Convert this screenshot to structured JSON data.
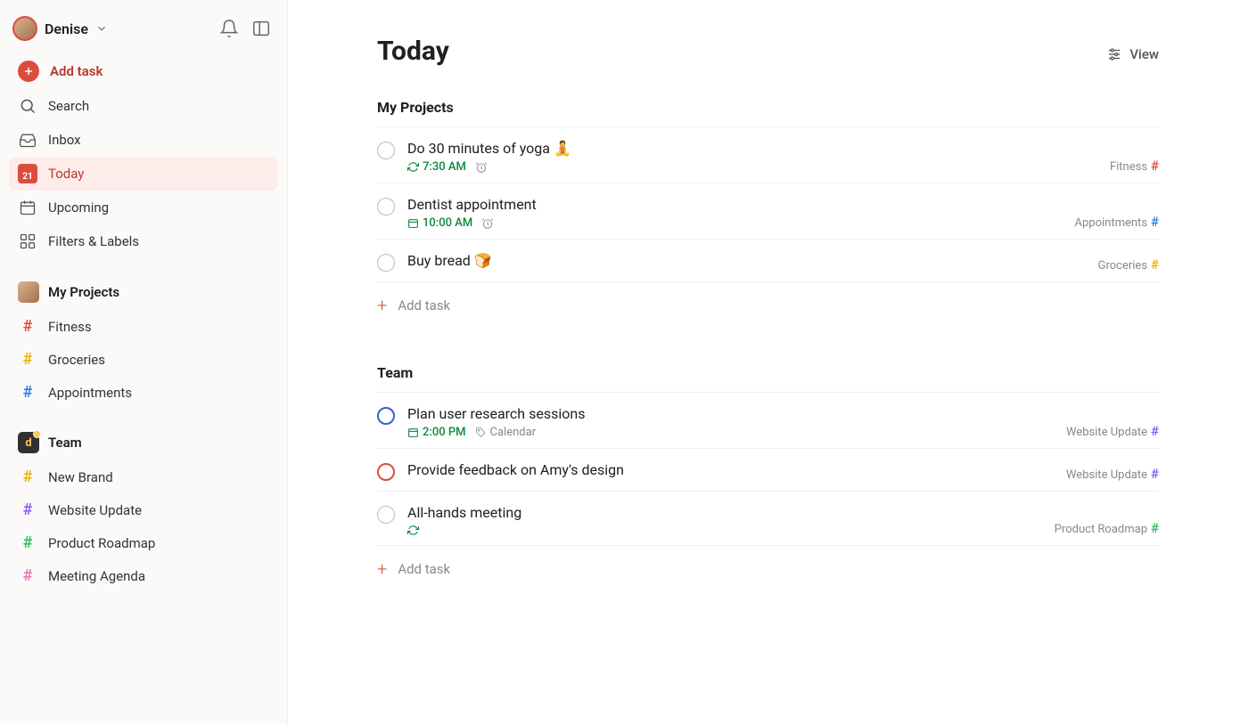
{
  "user": {
    "name": "Denise"
  },
  "sidebar": {
    "add_task": "Add task",
    "nav": [
      {
        "label": "Search",
        "icon": "search"
      },
      {
        "label": "Inbox",
        "icon": "inbox"
      },
      {
        "label": "Today",
        "icon": "calendar-today",
        "badge": "21",
        "active": true
      },
      {
        "label": "Upcoming",
        "icon": "calendar"
      },
      {
        "label": "Filters & Labels",
        "icon": "grid"
      }
    ],
    "projects_section": {
      "title": "My Projects",
      "items": [
        {
          "label": "Fitness",
          "color": "#dc4c3e"
        },
        {
          "label": "Groceries",
          "color": "#eab308"
        },
        {
          "label": "Appointments",
          "color": "#2c7be5"
        }
      ]
    },
    "team_section": {
      "title": "Team",
      "items": [
        {
          "label": "New Brand",
          "color": "#eab308"
        },
        {
          "label": "Website Update",
          "color": "#8b5cf6"
        },
        {
          "label": "Product Roadmap",
          "color": "#22c55e"
        },
        {
          "label": "Meeting Agenda",
          "color": "#f472b6"
        }
      ]
    }
  },
  "main": {
    "title": "Today",
    "view_label": "View",
    "groups": [
      {
        "title": "My Projects",
        "tasks": [
          {
            "title": "Do 30 minutes of yoga 🧘",
            "time": "7:30 AM",
            "recurring": true,
            "reminder": true,
            "project": {
              "name": "Fitness",
              "color": "#dc4c3e"
            }
          },
          {
            "title": "Dentist appointment",
            "time": "10:00 AM",
            "date_icon": true,
            "reminder": true,
            "project": {
              "name": "Appointments",
              "color": "#2c7be5"
            }
          },
          {
            "title": "Buy bread 🍞",
            "project": {
              "name": "Groceries",
              "color": "#eab308"
            }
          }
        ],
        "add_task_label": "Add task"
      },
      {
        "title": "Team",
        "tasks": [
          {
            "title": "Plan user research sessions",
            "time": "2:00 PM",
            "date_icon": true,
            "label_tag": "Calendar",
            "priority": "blue",
            "project": {
              "name": "Website Update",
              "color": "#8b5cf6"
            }
          },
          {
            "title": "Provide feedback on Amy's design",
            "priority": "red",
            "project": {
              "name": "Website Update",
              "color": "#8b5cf6"
            }
          },
          {
            "title": "All-hands meeting",
            "recurring": true,
            "project": {
              "name": "Product Roadmap",
              "color": "#22c55e"
            }
          }
        ],
        "add_task_label": "Add task"
      }
    ]
  }
}
